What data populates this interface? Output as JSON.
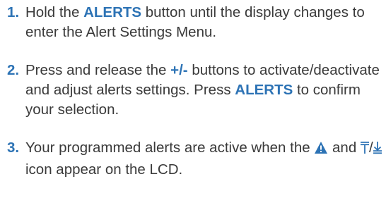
{
  "colors": {
    "accent": "#2d73b5",
    "text": "#3a3a3a"
  },
  "steps": [
    {
      "number": "1.",
      "text_a": "Hold the ",
      "kw": "ALERTS",
      "text_b": " button until the display changes to enter the Alert Settings Menu."
    },
    {
      "number": "2.",
      "text_a": "Press and release the ",
      "kw1": "+/-",
      "text_b": " buttons to activate/deactivate and adjust alerts settings. Press ",
      "kw2": "ALERTS",
      "text_c": " to confirm your selection."
    },
    {
      "number": "3.",
      "text_a": "Your programmed alerts are active when the ",
      "text_b": " and ",
      "text_c": "/",
      "text_d": " icon appear on the LCD.",
      "icons": [
        "warning-triangle-icon",
        "rise-arrow-icon",
        "fall-arrow-icon"
      ]
    }
  ]
}
